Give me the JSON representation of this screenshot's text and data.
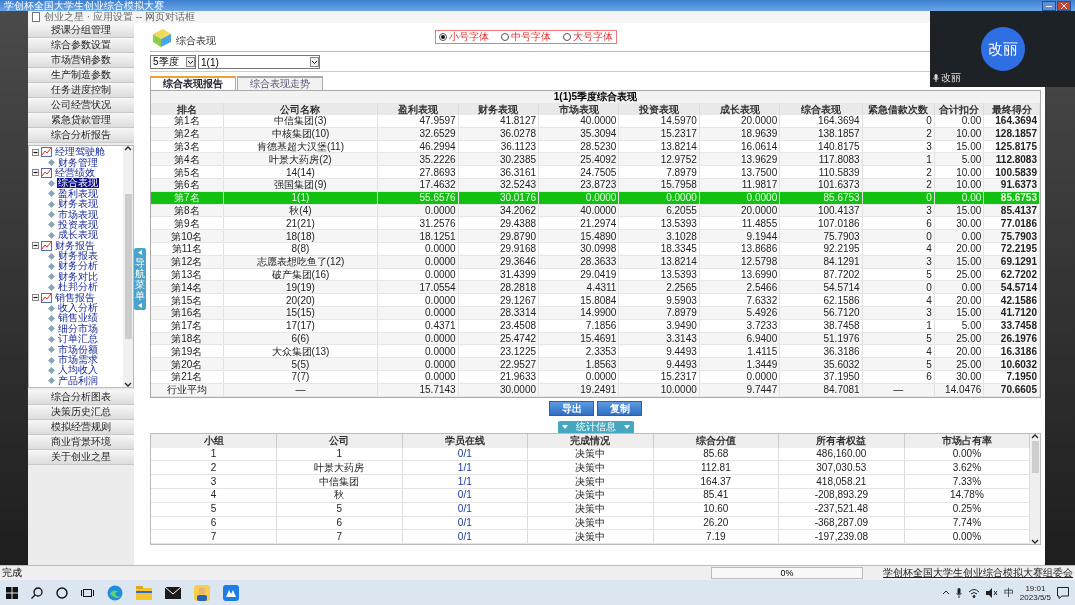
{
  "window": {
    "title": "学创杯全国大学生创业综合模拟大赛"
  },
  "breadcrumb": "创业之星 · 应用设置 -- 网页对话框",
  "sidebar": {
    "top_menu": [
      "授课分组管理",
      "综合参数设置",
      "市场营销参数",
      "生产制造参数",
      "任务进度控制",
      "公司经营状况",
      "紧急贷款管理",
      "综合分析报告"
    ],
    "tree": [
      {
        "label": "经理驾驶舱",
        "expanded": true,
        "selected": false,
        "children": [
          {
            "label": "财务管理",
            "selected": false
          }
        ]
      },
      {
        "label": "经营绩效",
        "expanded": true,
        "selected": false,
        "children": [
          {
            "label": "综合表现",
            "selected": true
          },
          {
            "label": "盈利表现",
            "selected": false
          },
          {
            "label": "财务表现",
            "selected": false
          },
          {
            "label": "市场表现",
            "selected": false
          },
          {
            "label": "投资表现",
            "selected": false
          },
          {
            "label": "成长表现",
            "selected": false
          }
        ]
      },
      {
        "label": "财务报告",
        "expanded": true,
        "selected": false,
        "children": [
          {
            "label": "财务报表",
            "selected": false
          },
          {
            "label": "财务分析",
            "selected": false
          },
          {
            "label": "财务对比",
            "selected": false
          },
          {
            "label": "杜邦分析",
            "selected": false
          }
        ]
      },
      {
        "label": "销售报告",
        "expanded": true,
        "selected": false,
        "children": [
          {
            "label": "收入分析",
            "selected": false
          },
          {
            "label": "销售业绩",
            "selected": false
          },
          {
            "label": "细分市场",
            "selected": false
          },
          {
            "label": "订单汇总",
            "selected": false
          },
          {
            "label": "市场份额",
            "selected": false
          },
          {
            "label": "市场需求",
            "selected": false
          },
          {
            "label": "人均收入",
            "selected": false
          },
          {
            "label": "产品利润",
            "selected": false
          }
        ]
      }
    ],
    "bottom_menu": [
      "综合分析图表",
      "决策历史汇总",
      "模拟经营规则",
      "商业背景环境",
      "关于创业之星"
    ],
    "nav_handle": "导航菜单"
  },
  "header": {
    "title": "综合表现",
    "font_size": [
      {
        "label": "小号字体",
        "selected": true
      },
      {
        "label": "中号字体",
        "selected": false
      },
      {
        "label": "大号字体",
        "selected": false
      }
    ]
  },
  "filters": {
    "quarter": "5季度",
    "company": "1(1)"
  },
  "tabs": [
    {
      "label": "综合表现报告",
      "selected": true
    },
    {
      "label": "综合表现走势",
      "selected": false
    }
  ],
  "table": {
    "title": "1(1)5季度综合表现",
    "columns": [
      "排名",
      "公司名称",
      "盈利表现",
      "财务表现",
      "市场表现",
      "投资表现",
      "成长表现",
      "综合表现",
      "紧急借款次数",
      "合计扣分",
      "最终得分"
    ],
    "rows": [
      {
        "selected": false,
        "cells": [
          "第1名",
          "中信集团(3)",
          "47.9597",
          "41.8127",
          "40.0000",
          "14.5970",
          "20.0000",
          "164.3694",
          "0",
          "0.00",
          "164.3694"
        ]
      },
      {
        "selected": false,
        "cells": [
          "第2名",
          "中核集团(10)",
          "32.6529",
          "36.0278",
          "35.3094",
          "15.2317",
          "18.9639",
          "138.1857",
          "2",
          "10.00",
          "128.1857"
        ]
      },
      {
        "selected": false,
        "cells": [
          "第3名",
          "肯德基超大汉堡(11)",
          "46.2994",
          "36.1123",
          "28.5230",
          "13.8214",
          "16.0614",
          "140.8175",
          "3",
          "15.00",
          "125.8175"
        ]
      },
      {
        "selected": false,
        "cells": [
          "第4名",
          "叶景大药房(2)",
          "35.2226",
          "30.2385",
          "25.4092",
          "12.9752",
          "13.9629",
          "117.8083",
          "1",
          "5.00",
          "112.8083"
        ]
      },
      {
        "selected": false,
        "cells": [
          "第5名",
          "14(14)",
          "27.8693",
          "36.3161",
          "24.7505",
          "7.8979",
          "13.7500",
          "110.5839",
          "2",
          "10.00",
          "100.5839"
        ]
      },
      {
        "selected": false,
        "cells": [
          "第6名",
          "强国集团(9)",
          "17.4632",
          "32.5243",
          "23.8723",
          "15.7958",
          "11.9817",
          "101.6373",
          "2",
          "10.00",
          "91.6373"
        ]
      },
      {
        "selected": true,
        "cells": [
          "第7名",
          "1(1)",
          "55.6576",
          "30.0176",
          "0.0000",
          "0.0000",
          "0.0000",
          "85.6753",
          "0",
          "0.00",
          "85.6753"
        ]
      },
      {
        "selected": false,
        "cells": [
          "第8名",
          "秋(4)",
          "0.0000",
          "34.2062",
          "40.0000",
          "6.2055",
          "20.0000",
          "100.4137",
          "3",
          "15.00",
          "85.4137"
        ]
      },
      {
        "selected": false,
        "cells": [
          "第9名",
          "21(21)",
          "31.2576",
          "29.4388",
          "21.2974",
          "13.5393",
          "11.4855",
          "107.0186",
          "6",
          "30.00",
          "77.0186"
        ]
      },
      {
        "selected": false,
        "cells": [
          "第10名",
          "18(18)",
          "18.1251",
          "29.8790",
          "15.4890",
          "3.1028",
          "9.1944",
          "75.7903",
          "0",
          "0.00",
          "75.7903"
        ]
      },
      {
        "selected": false,
        "cells": [
          "第11名",
          "8(8)",
          "0.0000",
          "29.9168",
          "30.0998",
          "18.3345",
          "13.8686",
          "92.2195",
          "4",
          "20.00",
          "72.2195"
        ]
      },
      {
        "selected": false,
        "cells": [
          "第12名",
          "志愿表想吃鱼了(12)",
          "0.0000",
          "29.3646",
          "28.3633",
          "13.8214",
          "12.5798",
          "84.1291",
          "3",
          "15.00",
          "69.1291"
        ]
      },
      {
        "selected": false,
        "cells": [
          "第13名",
          "破产集团(16)",
          "0.0000",
          "31.4399",
          "29.0419",
          "13.5393",
          "13.6990",
          "87.7202",
          "5",
          "25.00",
          "62.7202"
        ]
      },
      {
        "selected": false,
        "cells": [
          "第14名",
          "19(19)",
          "17.0554",
          "28.2818",
          "4.4311",
          "2.2565",
          "2.5466",
          "54.5714",
          "0",
          "0.00",
          "54.5714"
        ]
      },
      {
        "selected": false,
        "cells": [
          "第15名",
          "20(20)",
          "0.0000",
          "29.1267",
          "15.8084",
          "9.5903",
          "7.6332",
          "62.1586",
          "4",
          "20.00",
          "42.1586"
        ]
      },
      {
        "selected": false,
        "cells": [
          "第16名",
          "15(15)",
          "0.0000",
          "28.3314",
          "14.9900",
          "7.8979",
          "5.4926",
          "56.7120",
          "3",
          "15.00",
          "41.7120"
        ]
      },
      {
        "selected": false,
        "cells": [
          "第17名",
          "17(17)",
          "0.4371",
          "23.4508",
          "7.1856",
          "3.9490",
          "3.7233",
          "38.7458",
          "1",
          "5.00",
          "33.7458"
        ]
      },
      {
        "selected": false,
        "cells": [
          "第18名",
          "6(6)",
          "0.0000",
          "25.4742",
          "15.4691",
          "3.3143",
          "6.9400",
          "51.1976",
          "5",
          "25.00",
          "26.1976"
        ]
      },
      {
        "selected": false,
        "cells": [
          "第19名",
          "大众集团(13)",
          "0.0000",
          "23.1225",
          "2.3353",
          "9.4493",
          "1.4115",
          "36.3186",
          "4",
          "20.00",
          "16.3186"
        ]
      },
      {
        "selected": false,
        "cells": [
          "第20名",
          "5(5)",
          "0.0000",
          "22.9527",
          "1.8563",
          "9.4493",
          "1.3449",
          "35.6032",
          "5",
          "25.00",
          "10.6032"
        ]
      },
      {
        "selected": false,
        "cells": [
          "第21名",
          "7(7)",
          "0.0000",
          "21.9633",
          "0.0000",
          "15.2317",
          "0.0000",
          "37.1950",
          "6",
          "30.00",
          "7.1950"
        ]
      },
      {
        "selected": false,
        "cells": [
          "行业平均",
          "—",
          "15.7143",
          "30.0000",
          "19.2491",
          "10.0000",
          "9.7447",
          "84.7081",
          "—",
          "14.0476",
          "70.6605"
        ]
      }
    ]
  },
  "actions": [
    "导出",
    "复制"
  ],
  "stats_toggle": "统计信息",
  "stats_table": {
    "columns": [
      "小组",
      "公司",
      "学员在线",
      "完成情况",
      "综合分值",
      "所有者权益",
      "市场占有率"
    ],
    "rows": [
      [
        "1",
        "1",
        "0/1",
        "决策中",
        "85.68",
        "486,160.00",
        "0.00%"
      ],
      [
        "2",
        "叶景大药房",
        "1/1",
        "决策中",
        "112.81",
        "307,030.53",
        "3.62%"
      ],
      [
        "3",
        "中信集团",
        "1/1",
        "决策中",
        "164.37",
        "418,058.21",
        "7.33%"
      ],
      [
        "4",
        "秋",
        "0/1",
        "决策中",
        "85.41",
        "-208,893.29",
        "14.78%"
      ],
      [
        "5",
        "5",
        "0/1",
        "决策中",
        "10.60",
        "-237,521.48",
        "0.25%"
      ],
      [
        "6",
        "6",
        "0/1",
        "决策中",
        "26.20",
        "-368,287.09",
        "7.74%"
      ],
      [
        "7",
        "7",
        "0/1",
        "决策中",
        "7.19",
        "-197,239.08",
        "0.00%"
      ]
    ]
  },
  "video": {
    "initials": "改丽",
    "speaker": "改丽"
  },
  "status_bar": {
    "text": "完成",
    "progress": {
      "label": "0%",
      "level": 0
    },
    "link": "学创杯全国大学生创业综合模拟大赛组委会"
  },
  "taskbar": {
    "ime": "中",
    "time": "19:01",
    "date": "2023/5/5"
  }
}
